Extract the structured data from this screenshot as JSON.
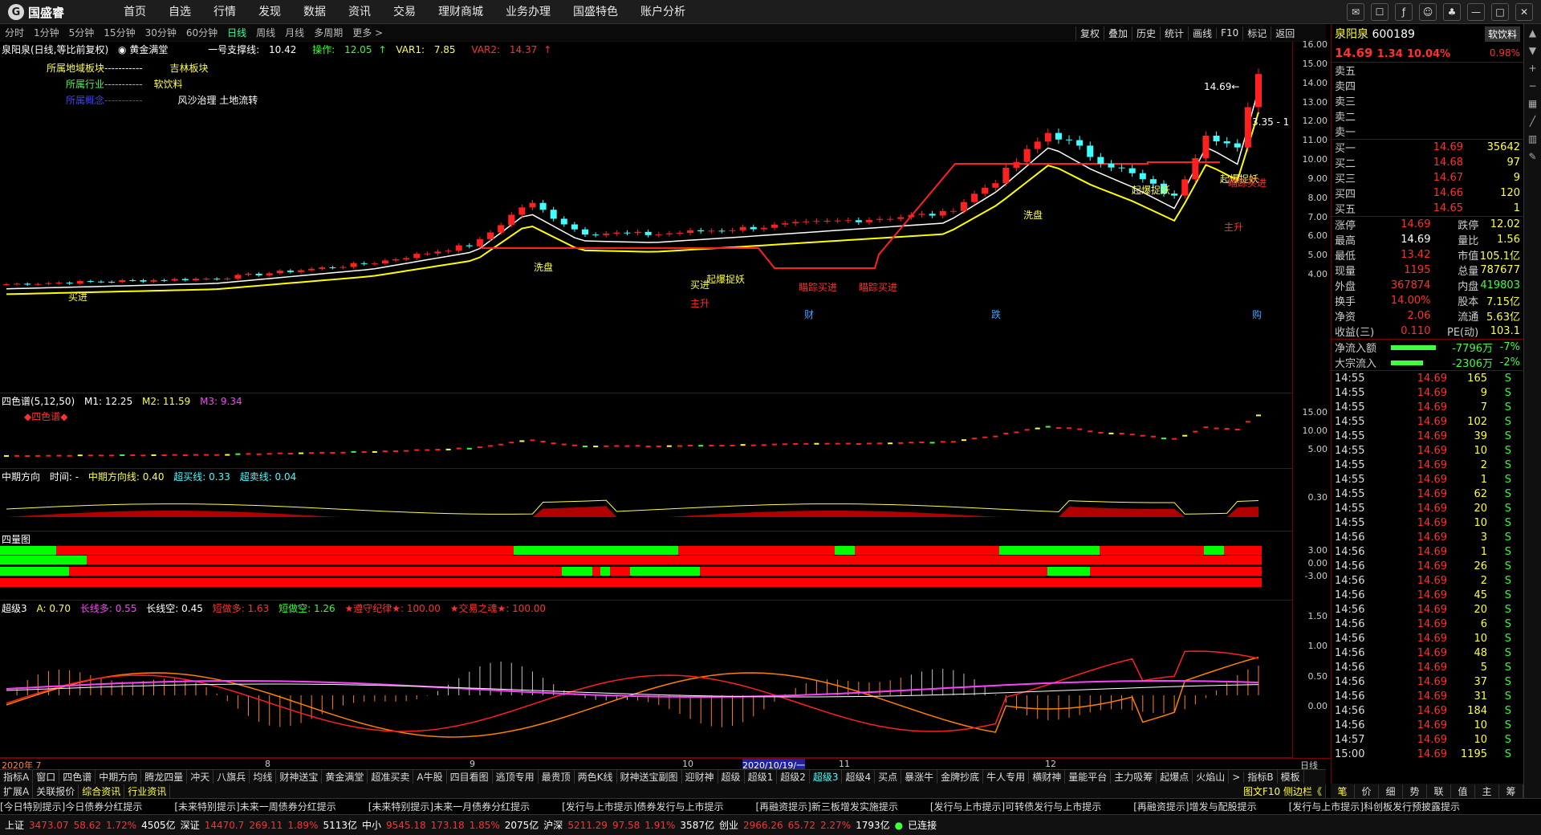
{
  "app": {
    "logo_text": "国盛睿",
    "nav": [
      "首页",
      "自选",
      "行情",
      "发现",
      "数据",
      "资讯",
      "交易",
      "理财商城",
      "业务办理",
      "国盛特色",
      "账户分析"
    ]
  },
  "periods": [
    "分时",
    "1分钟",
    "5分钟",
    "15分钟",
    "30分钟",
    "60分钟",
    "日线",
    "周线",
    "月线",
    "多周期",
    "更多 >"
  ],
  "active_period": "日线",
  "toolbar": [
    "复权",
    "叠加",
    "历史",
    "统计",
    "画线",
    "F10",
    "标记",
    "返回"
  ],
  "main": {
    "stock_label": "泉阳泉(日线,等比前复权)",
    "indicator": "黄金满堂",
    "support_label": "一号支撑线:",
    "support_val": "10.42",
    "op_label": "操作:",
    "op_val": "12.05",
    "var1_label": "VAR1:",
    "var1_val": "7.85",
    "var2_label": "VAR2:",
    "var2_val": "14.37",
    "region_label": "所属地域板块-----------",
    "region_val": "吉林板块",
    "industry_label": "所属行业-----------",
    "industry_val": "软饮料",
    "concept_label": "所属概念-----------",
    "concept_val": "风沙治理 土地流转",
    "yticks": [
      "16.00",
      "15.00",
      "14.00",
      "13.00",
      "12.00",
      "11.00",
      "10.00",
      "9.00",
      "8.00",
      "7.00",
      "6.00",
      "5.00",
      "4.00"
    ],
    "annotations": {
      "max": "14.69",
      "min": "3.35",
      "ladder": "起爆捉妖",
      "buy": "主升",
      "wash": "洗盘",
      "aim": "瞄踪买进",
      "buy2": "买进",
      "cai": "财",
      "die": "跌",
      "gou": "购"
    }
  },
  "p2": {
    "name": "四色谱(5,12,50)",
    "m1": "M1: 12.25",
    "m2": "M2: 11.59",
    "m3": "M3: 9.34",
    "tag": "◆四色谱◆",
    "yticks": [
      "15.00",
      "10.00",
      "5.00"
    ]
  },
  "p3": {
    "name": "中期方向",
    "t": "时间: -",
    "a": "中期方向线: 0.40",
    "b": "超买线: 0.33",
    "c": "超卖线: 0.04",
    "yticks": [
      "0.30"
    ]
  },
  "p4": {
    "name": "四量图",
    "yticks": [
      "3.00",
      "0.00",
      "-3.00"
    ]
  },
  "p5": {
    "name": "超级3",
    "a": "A: 0.70",
    "b": "长线多: 0.55",
    "c": "长线空: 0.45",
    "d": "短做多: 1.63",
    "e": "短做空: 1.26",
    "f": "★遵守纪律★: 100.00",
    "g": "★交易之魂★: 100.00",
    "yticks": [
      "1.50",
      "1.00",
      "0.50",
      "0.00"
    ]
  },
  "xaxis": {
    "labels": [
      "2020年 7",
      "8",
      "9",
      "10",
      "2020/10/19/一",
      "11",
      "12"
    ],
    "right": "日线"
  },
  "tabs1": [
    "指标A",
    "窗口",
    "四色谱",
    "中期方向",
    "腾龙四量",
    "冲天",
    "八旗兵",
    "均线",
    "财神送宝",
    "黄金满堂",
    "超准买卖",
    "A牛股",
    "四目看图",
    "逃顶专用",
    "最贵顶",
    "两色K线",
    "财神送宝副图",
    "迎财神",
    "超级",
    "超级1",
    "超级2",
    "超级3",
    "超级4",
    "买点",
    "暴涨牛",
    "金牌抄底",
    "牛人专用",
    "横财神",
    "量能平台",
    "主力吸筹",
    "起爆点",
    "火焰山",
    ">",
    "指标B",
    "模板"
  ],
  "tabs2": [
    "扩展A",
    "关联报价",
    "综合资讯",
    "行业资讯"
  ],
  "tabs2_right": "图文F10 侧边栏《",
  "quote": {
    "name": "泉阳泉",
    "code": "600189",
    "industry": "软饮料",
    "industry_chg": "0.98%",
    "price": "14.69",
    "chg": "1.34",
    "pct": "10.04%",
    "sells": [
      [
        "卖五",
        "",
        ""
      ],
      [
        "卖四",
        "",
        ""
      ],
      [
        "卖三",
        "",
        ""
      ],
      [
        "卖二",
        "",
        ""
      ],
      [
        "卖一",
        "",
        ""
      ]
    ],
    "buys": [
      [
        "买一",
        "14.69",
        "35642"
      ],
      [
        "买二",
        "14.68",
        "97"
      ],
      [
        "买三",
        "14.67",
        "9"
      ],
      [
        "买四",
        "14.66",
        "120"
      ],
      [
        "买五",
        "14.65",
        "1"
      ]
    ],
    "stats": [
      [
        "涨停",
        "14.69",
        "跌停",
        "12.02"
      ],
      [
        "最高",
        "14.69",
        "量比",
        "1.56"
      ],
      [
        "最低",
        "13.42",
        "市值",
        "105.1亿"
      ],
      [
        "现量",
        "1195",
        "总量",
        "787677"
      ],
      [
        "外盘",
        "367874",
        "内盘",
        "419803"
      ],
      [
        "换手",
        "14.00%",
        "股本",
        "7.15亿"
      ],
      [
        "净资",
        "2.06",
        "流通",
        "5.63亿"
      ],
      [
        "收益(三)",
        "0.110",
        "PE(动)",
        "103.1"
      ]
    ],
    "flow": [
      [
        "净流入额",
        "-7796万",
        "-7%"
      ],
      [
        "大宗流入",
        "-2306万",
        "-2%"
      ]
    ],
    "ticks": [
      [
        "14:55",
        "14.69",
        "165",
        "S"
      ],
      [
        "14:55",
        "14.69",
        "9",
        "S"
      ],
      [
        "14:55",
        "14.69",
        "7",
        "S"
      ],
      [
        "14:55",
        "14.69",
        "102",
        "S"
      ],
      [
        "14:55",
        "14.69",
        "39",
        "S"
      ],
      [
        "14:55",
        "14.69",
        "10",
        "S"
      ],
      [
        "14:55",
        "14.69",
        "2",
        "S"
      ],
      [
        "14:55",
        "14.69",
        "1",
        "S"
      ],
      [
        "14:55",
        "14.69",
        "62",
        "S"
      ],
      [
        "14:55",
        "14.69",
        "20",
        "S"
      ],
      [
        "14:55",
        "14.69",
        "10",
        "S"
      ],
      [
        "14:56",
        "14.69",
        "3",
        "S"
      ],
      [
        "14:56",
        "14.69",
        "1",
        "S"
      ],
      [
        "14:56",
        "14.69",
        "26",
        "S"
      ],
      [
        "14:56",
        "14.69",
        "2",
        "S"
      ],
      [
        "14:56",
        "14.69",
        "45",
        "S"
      ],
      [
        "14:56",
        "14.69",
        "20",
        "S"
      ],
      [
        "14:56",
        "14.69",
        "6",
        "S"
      ],
      [
        "14:56",
        "14.69",
        "10",
        "S"
      ],
      [
        "14:56",
        "14.69",
        "48",
        "S"
      ],
      [
        "14:56",
        "14.69",
        "5",
        "S"
      ],
      [
        "14:56",
        "14.69",
        "37",
        "S"
      ],
      [
        "14:56",
        "14.69",
        "31",
        "S"
      ],
      [
        "14:56",
        "14.69",
        "184",
        "S"
      ],
      [
        "14:56",
        "14.69",
        "10",
        "S"
      ],
      [
        "14:57",
        "14.69",
        "10",
        "S"
      ],
      [
        "15:00",
        "14.69",
        "1195",
        "S"
      ]
    ]
  },
  "rtabs": [
    "笔",
    "价",
    "细",
    "势",
    "联",
    "值",
    "主",
    "筹"
  ],
  "ticker": [
    "[今日特别提示]今日债券分红提示",
    "[未来特别提示]未来一周债券分红提示",
    "[未来特别提示]未来一月债券分红提示",
    "[发行与上市提示]债券发行与上市提示",
    "[再融资提示]新三板增发实施提示",
    "[发行与上市提示]可转债发行与上市提示",
    "[再融资提示]增发与配股提示",
    "[发行与上市提示]科创板发行预披露提示"
  ],
  "status": {
    "sh": "上证",
    "sh_v": "3473.07",
    "sh_c": "58.62",
    "sh_p": "1.72%",
    "sh_a": "4505亿",
    "sz": "深证",
    "sz_v": "14470.7",
    "sz_c": "269.11",
    "sz_p": "1.89%",
    "sz_a": "5113亿",
    "zx": "中小",
    "zx_v": "9545.18",
    "zx_c": "173.18",
    "zx_p": "1.85%",
    "zx_a": "2075亿",
    "hs": "沪深",
    "hs_v": "5211.29",
    "hs_c": "97.58",
    "hs_p": "1.91%",
    "hs_a": "3587亿",
    "cy": "创业",
    "cy_v": "2966.26",
    "cy_c": "65.72",
    "cy_p": "2.27%",
    "cy_a": "1793亿",
    "conn": "已连接"
  }
}
